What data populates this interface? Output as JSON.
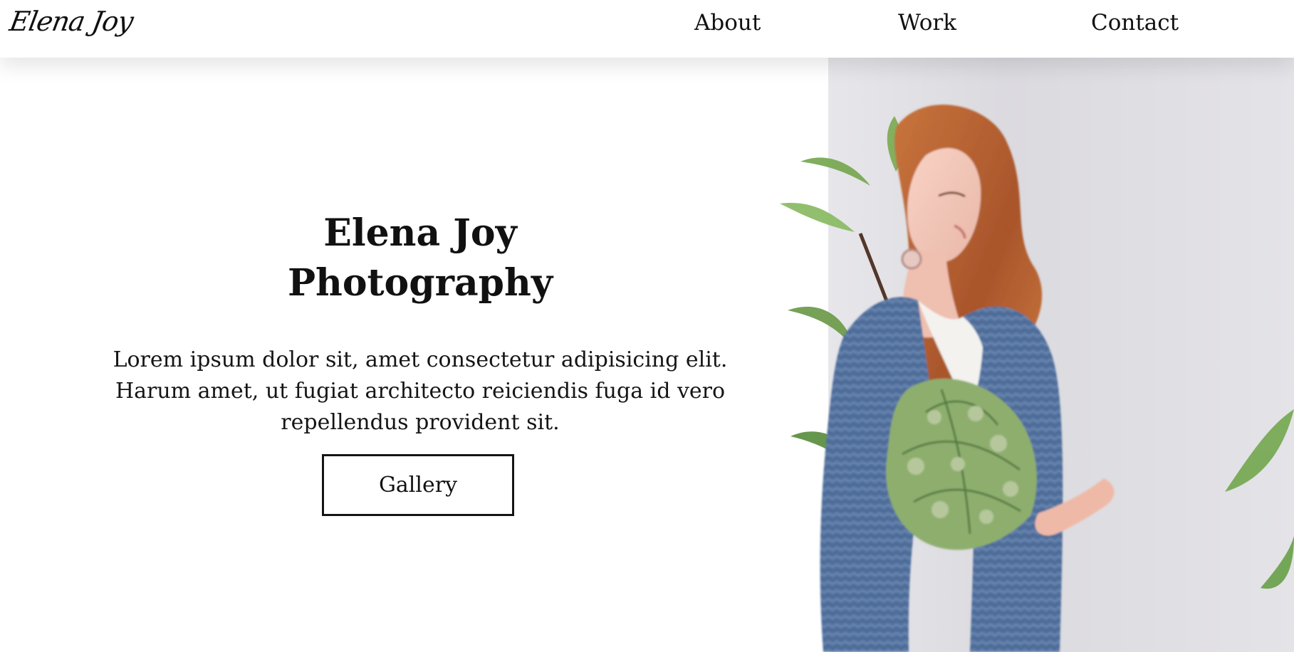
{
  "brand": {
    "logo_text": "Elena Joy"
  },
  "navigation": {
    "items": [
      {
        "label": "About"
      },
      {
        "label": "Work"
      },
      {
        "label": "Contact"
      }
    ]
  },
  "hero": {
    "title_lines": [
      "Elena Joy",
      "Photography"
    ],
    "description_lines": [
      "Lorem ipsum dolor sit, amet consectetur adipisicing elit.",
      "Harum amet, ut fugiat architecto reiciendis fuga id vero",
      "repellendus provident sit."
    ],
    "button_label": "Gallery"
  },
  "colors": {
    "background": "#ffffff",
    "text": "#111111",
    "photo_background": "#dcdbe0",
    "hair": "#b8642f",
    "cardigan": "#55739f",
    "leaf_green": "#6aa84f",
    "bouquet_green": "#8cad6d"
  },
  "image": {
    "name": "portrait-photo",
    "subject_icon": "portrait-photo-icon"
  }
}
